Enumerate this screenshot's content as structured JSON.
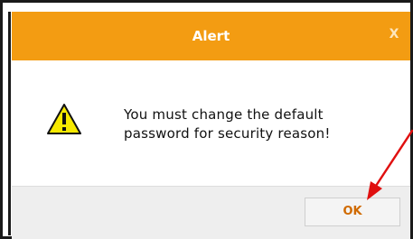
{
  "dialog": {
    "title": "Alert",
    "close_label": "X",
    "message_line1": "You must change the default",
    "message_line2": "password for security reason!",
    "ok_label": "OK"
  },
  "icons": {
    "warning": "warning-triangle-icon",
    "close": "close-icon",
    "annotation_arrow": "red-arrow-annotation"
  },
  "colors": {
    "header": "#f39c12",
    "ok_text": "#d06a00",
    "arrow": "#e01010"
  }
}
